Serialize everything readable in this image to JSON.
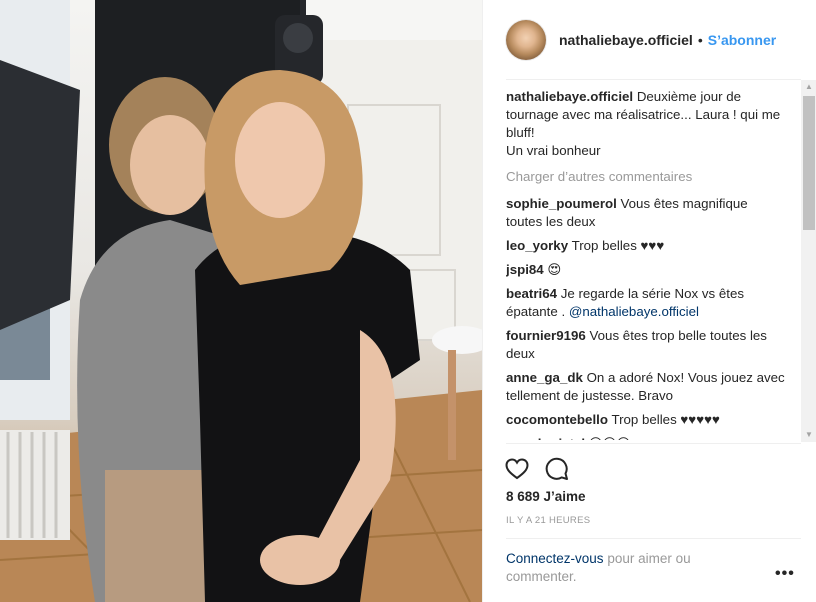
{
  "post": {
    "username": "nathaliebaye.officiel",
    "dot": "•",
    "follow_label": "S’abonner",
    "caption_user": "nathaliebaye.officiel",
    "caption_text": "Deuxième jour de tournage avec ma réalisatrice... Laura ! qui me bluff!",
    "caption_text2": "Un vrai bonheur",
    "load_more": "Charger d’autres commentaires",
    "comments": [
      {
        "user": "sophie_poumerol",
        "text": "Vous êtes magnifique toutes les deux"
      },
      {
        "user": "leo_yorky",
        "text": "Trop belles ♥♥♥"
      },
      {
        "user": "jspi84",
        "text": "😍"
      },
      {
        "user": "beatri64",
        "text": "Je regarde la série Nox vs êtes épatante .",
        "mention": "@nathaliebaye.officiel"
      },
      {
        "user": "fournier9196",
        "text": "Vous êtes trop belle toutes les deux"
      },
      {
        "user": "anne_ga_dk",
        "text": "On a adoré Nox! Vous jouez avec tellement de justesse. Bravo"
      },
      {
        "user": "cocomontebello",
        "text": "Trop belles ♥♥♥♥♥"
      },
      {
        "user": "marcheristel",
        "text": "😍😍😍"
      }
    ],
    "likes": "8 689 J’aime",
    "timestamp": "IL Y A 21 HEURES",
    "login_link": "Connectez-vous",
    "login_text": " pour aimer ou commenter.",
    "more_label": "•••",
    "icons": {
      "like": "heart-icon",
      "comment": "comment-icon",
      "more": "more-options-icon"
    }
  }
}
